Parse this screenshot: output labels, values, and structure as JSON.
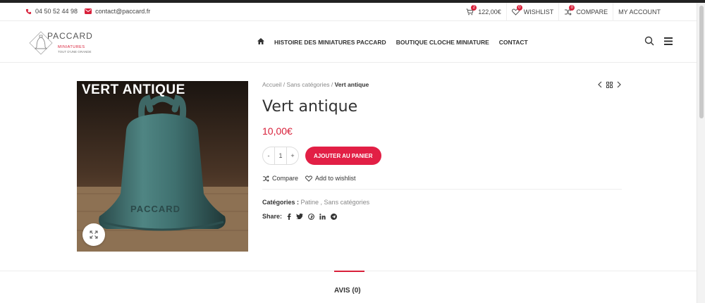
{
  "topbar": {
    "phone": "04 50 52 44 98",
    "email": "contact@paccard.fr",
    "cart_count": "2",
    "cart_total": "122,00€",
    "wishlist_count": "0",
    "wishlist_label": "WISHLIST",
    "compare_count": "0",
    "compare_label": "COMPARE",
    "account_label": "MY ACCOUNT"
  },
  "header": {
    "logo_title": "PACCARD",
    "logo_sub": "MINIATURES",
    "logo_sub2": "TOUT D'UNE GRANDE",
    "nav": [
      {
        "label": "HISTOIRE DES MINIATURES PACCARD"
      },
      {
        "label": "BOUTIQUE CLOCHE MINIATURE"
      },
      {
        "label": "CONTACT"
      }
    ]
  },
  "product": {
    "image_title": "VERT ANTIQUE",
    "bell_text": "PACCARD",
    "breadcrumb": {
      "home": "Accueil",
      "sep": "/",
      "category": "Sans catégories",
      "current": "Vert antique"
    },
    "title": "Vert antique",
    "price": "10,00€",
    "qty": {
      "minus": "-",
      "value": "1",
      "plus": "+"
    },
    "add_to_cart": "AJOUTER AU PANIER",
    "compare": "Compare",
    "wishlist": "Add to wishlist",
    "categories_label": "Catégories :",
    "categories": "Patine , Sans catégories",
    "share_label": "Share:"
  },
  "tabs": [
    {
      "label": "AVIS (0)"
    }
  ],
  "colors": {
    "accent": "#d8203a",
    "button": "#e21f45"
  },
  "icons": [
    "phone-icon",
    "mail-icon",
    "cart-icon",
    "heart-icon",
    "compare-icon",
    "home-icon",
    "search-icon",
    "menu-icon",
    "expand-icon",
    "facebook-icon",
    "twitter-icon",
    "pinterest-icon",
    "linkedin-icon",
    "telegram-icon"
  ]
}
